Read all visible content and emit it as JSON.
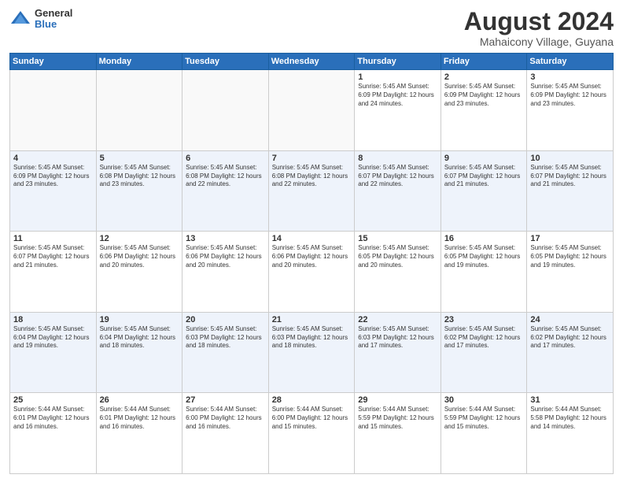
{
  "logo": {
    "general": "General",
    "blue": "Blue"
  },
  "header": {
    "title": "August 2024",
    "subtitle": "Mahaicony Village, Guyana"
  },
  "days_of_week": [
    "Sunday",
    "Monday",
    "Tuesday",
    "Wednesday",
    "Thursday",
    "Friday",
    "Saturday"
  ],
  "weeks": [
    [
      {
        "day": "",
        "info": ""
      },
      {
        "day": "",
        "info": ""
      },
      {
        "day": "",
        "info": ""
      },
      {
        "day": "",
        "info": ""
      },
      {
        "day": "1",
        "info": "Sunrise: 5:45 AM\nSunset: 6:09 PM\nDaylight: 12 hours\nand 24 minutes."
      },
      {
        "day": "2",
        "info": "Sunrise: 5:45 AM\nSunset: 6:09 PM\nDaylight: 12 hours\nand 23 minutes."
      },
      {
        "day": "3",
        "info": "Sunrise: 5:45 AM\nSunset: 6:09 PM\nDaylight: 12 hours\nand 23 minutes."
      }
    ],
    [
      {
        "day": "4",
        "info": "Sunrise: 5:45 AM\nSunset: 6:09 PM\nDaylight: 12 hours\nand 23 minutes."
      },
      {
        "day": "5",
        "info": "Sunrise: 5:45 AM\nSunset: 6:08 PM\nDaylight: 12 hours\nand 23 minutes."
      },
      {
        "day": "6",
        "info": "Sunrise: 5:45 AM\nSunset: 6:08 PM\nDaylight: 12 hours\nand 22 minutes."
      },
      {
        "day": "7",
        "info": "Sunrise: 5:45 AM\nSunset: 6:08 PM\nDaylight: 12 hours\nand 22 minutes."
      },
      {
        "day": "8",
        "info": "Sunrise: 5:45 AM\nSunset: 6:07 PM\nDaylight: 12 hours\nand 22 minutes."
      },
      {
        "day": "9",
        "info": "Sunrise: 5:45 AM\nSunset: 6:07 PM\nDaylight: 12 hours\nand 21 minutes."
      },
      {
        "day": "10",
        "info": "Sunrise: 5:45 AM\nSunset: 6:07 PM\nDaylight: 12 hours\nand 21 minutes."
      }
    ],
    [
      {
        "day": "11",
        "info": "Sunrise: 5:45 AM\nSunset: 6:07 PM\nDaylight: 12 hours\nand 21 minutes."
      },
      {
        "day": "12",
        "info": "Sunrise: 5:45 AM\nSunset: 6:06 PM\nDaylight: 12 hours\nand 20 minutes."
      },
      {
        "day": "13",
        "info": "Sunrise: 5:45 AM\nSunset: 6:06 PM\nDaylight: 12 hours\nand 20 minutes."
      },
      {
        "day": "14",
        "info": "Sunrise: 5:45 AM\nSunset: 6:06 PM\nDaylight: 12 hours\nand 20 minutes."
      },
      {
        "day": "15",
        "info": "Sunrise: 5:45 AM\nSunset: 6:05 PM\nDaylight: 12 hours\nand 20 minutes."
      },
      {
        "day": "16",
        "info": "Sunrise: 5:45 AM\nSunset: 6:05 PM\nDaylight: 12 hours\nand 19 minutes."
      },
      {
        "day": "17",
        "info": "Sunrise: 5:45 AM\nSunset: 6:05 PM\nDaylight: 12 hours\nand 19 minutes."
      }
    ],
    [
      {
        "day": "18",
        "info": "Sunrise: 5:45 AM\nSunset: 6:04 PM\nDaylight: 12 hours\nand 19 minutes."
      },
      {
        "day": "19",
        "info": "Sunrise: 5:45 AM\nSunset: 6:04 PM\nDaylight: 12 hours\nand 18 minutes."
      },
      {
        "day": "20",
        "info": "Sunrise: 5:45 AM\nSunset: 6:03 PM\nDaylight: 12 hours\nand 18 minutes."
      },
      {
        "day": "21",
        "info": "Sunrise: 5:45 AM\nSunset: 6:03 PM\nDaylight: 12 hours\nand 18 minutes."
      },
      {
        "day": "22",
        "info": "Sunrise: 5:45 AM\nSunset: 6:03 PM\nDaylight: 12 hours\nand 17 minutes."
      },
      {
        "day": "23",
        "info": "Sunrise: 5:45 AM\nSunset: 6:02 PM\nDaylight: 12 hours\nand 17 minutes."
      },
      {
        "day": "24",
        "info": "Sunrise: 5:45 AM\nSunset: 6:02 PM\nDaylight: 12 hours\nand 17 minutes."
      }
    ],
    [
      {
        "day": "25",
        "info": "Sunrise: 5:44 AM\nSunset: 6:01 PM\nDaylight: 12 hours\nand 16 minutes."
      },
      {
        "day": "26",
        "info": "Sunrise: 5:44 AM\nSunset: 6:01 PM\nDaylight: 12 hours\nand 16 minutes."
      },
      {
        "day": "27",
        "info": "Sunrise: 5:44 AM\nSunset: 6:00 PM\nDaylight: 12 hours\nand 16 minutes."
      },
      {
        "day": "28",
        "info": "Sunrise: 5:44 AM\nSunset: 6:00 PM\nDaylight: 12 hours\nand 15 minutes."
      },
      {
        "day": "29",
        "info": "Sunrise: 5:44 AM\nSunset: 5:59 PM\nDaylight: 12 hours\nand 15 minutes."
      },
      {
        "day": "30",
        "info": "Sunrise: 5:44 AM\nSunset: 5:59 PM\nDaylight: 12 hours\nand 15 minutes."
      },
      {
        "day": "31",
        "info": "Sunrise: 5:44 AM\nSunset: 5:58 PM\nDaylight: 12 hours\nand 14 minutes."
      }
    ]
  ]
}
